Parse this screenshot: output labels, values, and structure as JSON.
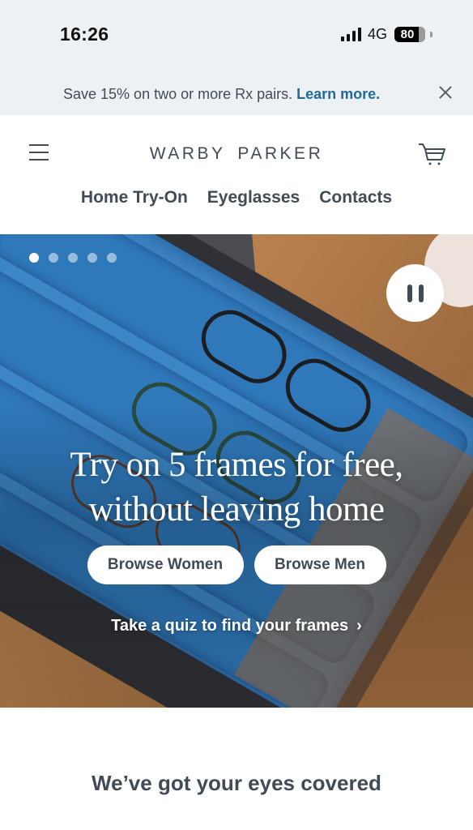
{
  "status_bar": {
    "time": "16:26",
    "network": "4G",
    "battery_percent": "80",
    "battery_level": 0.8,
    "icons": [
      "signal-bars-icon",
      "battery-icon"
    ]
  },
  "promo_banner": {
    "text": "Save 15% on two or more Rx pairs.",
    "link_label": "Learn more.",
    "link_color": "#206a9c",
    "close_icon": "close-icon"
  },
  "header": {
    "logo": "WARBY PARKER",
    "menu_icon": "hamburger-menu-icon",
    "cart_icon": "shopping-cart-icon",
    "nav": [
      {
        "label": "Home Try-On"
      },
      {
        "label": "Eyeglasses"
      },
      {
        "label": "Contacts"
      }
    ]
  },
  "hero": {
    "carousel": {
      "total_slides": 5,
      "active_slide": 1
    },
    "pause_icon": "pause-icon",
    "title_line1": "Try on 5 frames for free,",
    "title_line2": "without leaving home",
    "buttons": [
      {
        "label": "Browse Women"
      },
      {
        "label": "Browse Men"
      }
    ],
    "quiz_link": "Take a quiz to find your frames",
    "quiz_chevron": "›"
  },
  "section": {
    "title": "We’ve got your eyes covered"
  },
  "colors": {
    "text_primary": "#414b56",
    "banner_bg": "#eef1f4",
    "box_blue": "#3d86c6"
  }
}
